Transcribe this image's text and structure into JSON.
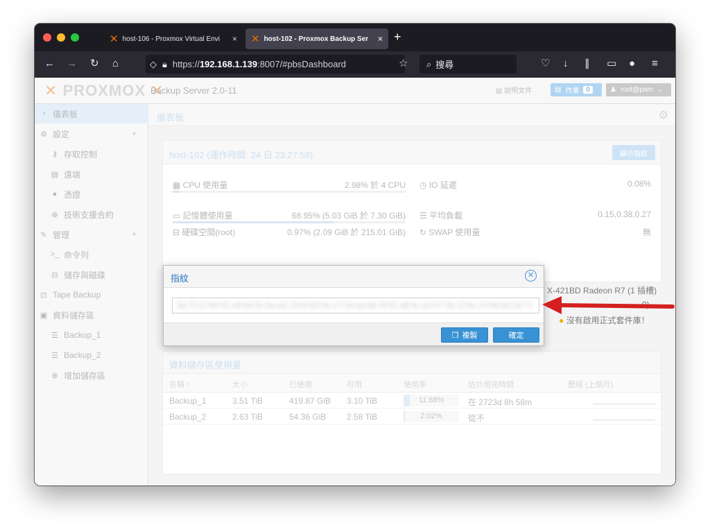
{
  "browser": {
    "tabs": [
      {
        "label": "host-106 - Proxmox Virtual Envi",
        "close": "×"
      },
      {
        "label": "host-102 - Proxmox Backup Ser",
        "close": "×"
      }
    ],
    "new_tab": "+",
    "url_prefix": "https://",
    "url_host": "192.168.1.139",
    "url_rest": ":8007/#pbsDashboard",
    "search_placeholder": "搜尋"
  },
  "app": {
    "logo_text": "PROXMOX",
    "product": "Backup Server 2.0-11",
    "docs_label": "說明文件",
    "tasks_label": "作業",
    "tasks_count": "0",
    "user_label": "root@pam"
  },
  "sidebar": {
    "items": [
      {
        "label": "儀表板",
        "icon": "dashboard-icon"
      },
      {
        "label": "設定",
        "icon": "gears-icon"
      },
      {
        "label": "存取控制",
        "icon": "key-icon"
      },
      {
        "label": "遠端",
        "icon": "server-icon"
      },
      {
        "label": "憑證",
        "icon": "certificate-icon"
      },
      {
        "label": "技術支援合約",
        "icon": "support-icon"
      },
      {
        "label": "管理",
        "icon": "wrench-icon"
      },
      {
        "label": "命令列",
        "icon": "terminal-icon"
      },
      {
        "label": "儲存與磁碟",
        "icon": "hdd-icon"
      },
      {
        "label": "Tape Backup",
        "icon": "tape-icon"
      },
      {
        "label": "資料儲存區",
        "icon": "archive-icon"
      },
      {
        "label": "Backup_1",
        "icon": "database-icon"
      },
      {
        "label": "Backup_2",
        "icon": "database-icon"
      },
      {
        "label": "增加儲存區",
        "icon": "plus-circle-icon"
      }
    ]
  },
  "main": {
    "title": "儀表板"
  },
  "host_panel": {
    "title": "host-102 (運作時間: 24 日 23:27:59)",
    "fingerprint_button": "顯示指紋",
    "cpu_label": "CPU 使用量",
    "cpu_value": "2.98% 於 4 CPU",
    "cpu_usage": 0.0298,
    "io_label": "IO 延遲",
    "io_value": "0.08%",
    "mem_label": "記憶體使用量",
    "mem_value": "68.95% (5.03 GiB 於 7.30 GiB)",
    "mem_usage": 0.6895,
    "load_label": "平均負載",
    "load_value": "0.15,0.38,0.27",
    "disk_label": "硬碟空間(root)",
    "disk_value": "0.97% (2.09 GiB 於 215.01 GiB)",
    "swap_label": "SWAP 使用量",
    "swap_value": "無",
    "cpu_model_partial": "X-421BD Radeon R7 (1 插槽)",
    "kernel_partial": "0)",
    "repo_partial": "沒有啟用正式套件庫！"
  },
  "datastore_table": {
    "title": "資料儲存區使用量",
    "columns": [
      "名稱 ↑",
      "大小",
      "已使用",
      "可用",
      "使用率",
      "估計用完時間",
      "歷程 (上個月)"
    ],
    "rows": [
      {
        "name": "Backup_1",
        "size": "3.51 TiB",
        "used": "419.87 GiB",
        "avail": "3.10 TiB",
        "usage_text": "11.68%",
        "usage": 0.1168,
        "estimate": "在 2723d 8h 58m"
      },
      {
        "name": "Backup_2",
        "size": "2.63 TiB",
        "used": "54.36 GiB",
        "avail": "2.58 TiB",
        "usage_text": "2.02%",
        "usage": 0.0202,
        "estimate": "從不"
      }
    ]
  },
  "dialog": {
    "title": "指紋",
    "fingerprint_value": "3a:7f:2c:9d:41:e8:b5:0c:6a:d2:19:f4:83:5e:c7:20:aa:6b:3f:91:d8:4c:e2:07:5b:1f:9e:c3:68:a4:2d:71",
    "copy_label": "複製",
    "ok_label": "確定"
  },
  "colors": {
    "accent": "#3892d4",
    "proxmox_orange": "#e57000",
    "annotation_arrow": "#d42020"
  }
}
